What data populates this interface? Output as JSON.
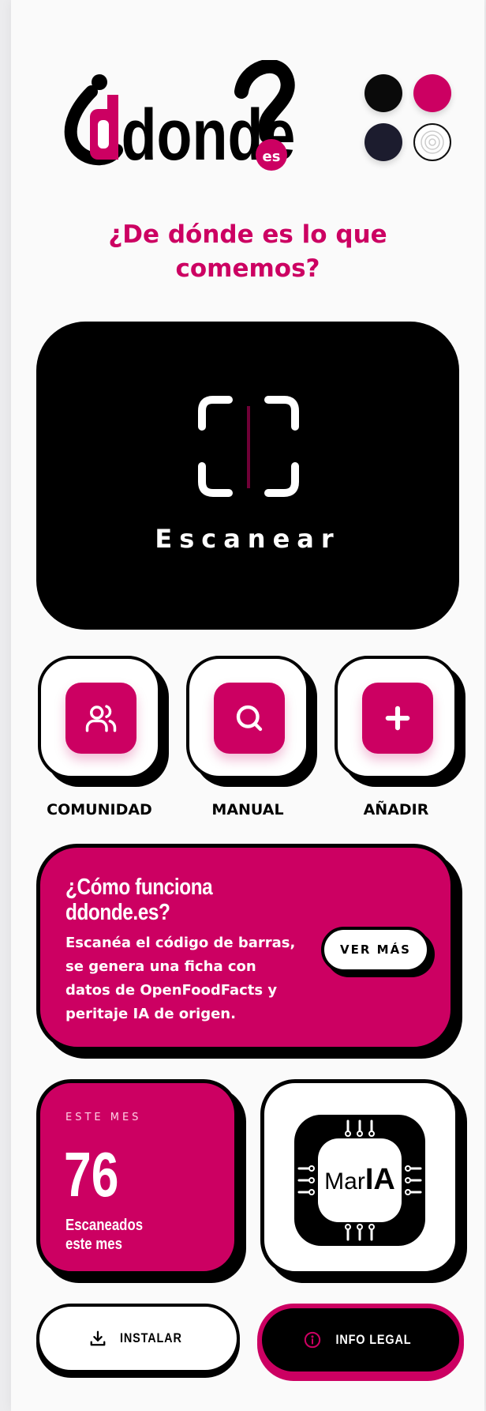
{
  "brand": {
    "logo_text": "¿ddonde?es",
    "colors": {
      "accent": "#cc0062",
      "dark": "#000000",
      "navy": "#1c1c2e",
      "light": "#ffffff"
    }
  },
  "theme_switcher": {
    "options": [
      "black",
      "pink",
      "navy",
      "white"
    ]
  },
  "tagline": "¿De dónde es lo que comemos?",
  "scan": {
    "label": "Escanear",
    "icon": "barcode-scan-icon"
  },
  "actions": [
    {
      "label": "COMUNIDAD",
      "icon": "users-icon"
    },
    {
      "label": "MANUAL",
      "icon": "search-icon"
    },
    {
      "label": "AÑADIR",
      "icon": "plus-icon"
    }
  ],
  "how_it_works": {
    "title": "¿Cómo funciona ddonde.es?",
    "text": "Escanéa el código de barras, se genera una ficha con datos de OpenFoodFacts y peritaje IA de origen.",
    "button": "VER MÁS"
  },
  "stats": {
    "tag": "ESTE MES",
    "count": "76",
    "description": "Escaneados este mes"
  },
  "maria": {
    "logo_text": "MarIA",
    "icon": "chip-icon"
  },
  "footer": {
    "install_label": "INSTALAR",
    "install_icon": "download-icon",
    "legal_label": "INFO LEGAL",
    "legal_icon": "info-icon"
  }
}
